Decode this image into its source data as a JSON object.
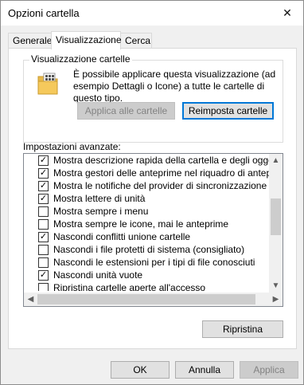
{
  "window": {
    "title": "Opzioni cartella"
  },
  "tabs": [
    {
      "label": "Generale",
      "active": false
    },
    {
      "label": "Visualizzazione",
      "active": true
    },
    {
      "label": "Cerca",
      "active": false
    }
  ],
  "folder_views": {
    "legend": "Visualizzazione cartelle",
    "description": "È possibile applicare questa visualizzazione (ad esempio Dettagli o Icone) a tutte le cartelle di questo tipo.",
    "apply_label": "Applica alle cartelle",
    "reset_label": "Reimposta cartelle"
  },
  "advanced": {
    "label": "Impostazioni avanzate:",
    "items": [
      {
        "label": "Mostra descrizione rapida della cartella e degli oggetti del",
        "checked": true
      },
      {
        "label": "Mostra gestori delle anteprime nel riquadro di anteprima",
        "checked": true
      },
      {
        "label": "Mostra le notifiche del provider di sincronizzazione",
        "checked": true
      },
      {
        "label": "Mostra lettere di unità",
        "checked": true
      },
      {
        "label": "Mostra sempre i menu",
        "checked": false
      },
      {
        "label": "Mostra sempre le icone, mai le anteprime",
        "checked": false
      },
      {
        "label": "Nascondi conflitti unione cartelle",
        "checked": true
      },
      {
        "label": "Nascondi i file protetti di sistema (consigliato)",
        "checked": false
      },
      {
        "label": "Nascondi le estensioni per i tipi di file conosciuti",
        "checked": false
      },
      {
        "label": "Nascondi unità vuote",
        "checked": true
      },
      {
        "label": "Ripristina cartelle aperte all'accesso",
        "checked": false
      }
    ],
    "restore_label": "Ripristina"
  },
  "footer": {
    "ok_label": "OK",
    "cancel_label": "Annulla",
    "apply_label": "Applica"
  },
  "icons": {
    "close": "close-icon",
    "folder": "folder-icon",
    "check": "checkmark-icon"
  }
}
